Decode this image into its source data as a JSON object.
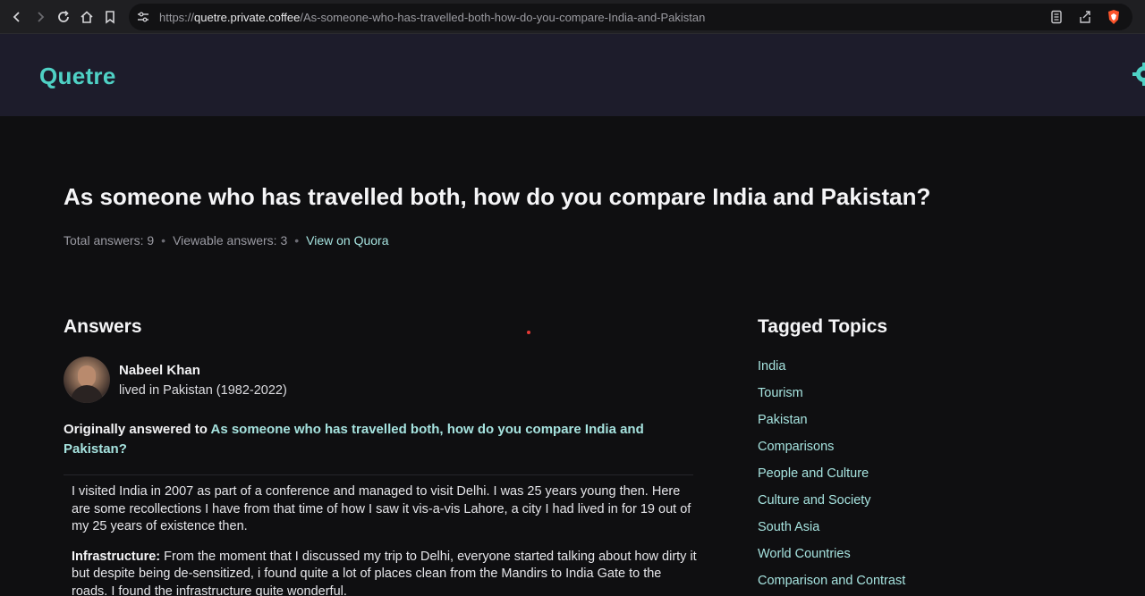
{
  "browser": {
    "url_prefix": "https://",
    "url_host": "quetre.private.coffee",
    "url_path": "/As-someone-who-has-travelled-both-how-do-you-compare-India-and-Pakistan"
  },
  "site": {
    "logo": "Quetre"
  },
  "question": {
    "title": "As someone who has travelled both, how do you compare India and Pakistan?",
    "total_answers": "Total answers: 9",
    "viewable_answers": "Viewable answers: 3",
    "view_on_quora": "View on Quora",
    "separator": "•"
  },
  "answers": {
    "heading": "Answers",
    "author_name": "Nabeel Khan",
    "author_credential": "lived in Pakistan (1982-2022)",
    "originally_prefix": "Originally answered to ",
    "originally_question": "As someone who has travelled both, how do you compare India and Pakistan?",
    "paragraph_1": "I visited India in 2007 as part of a conference and managed to visit Delhi. I was 25 years young then. Here are some recollections I have from that time of how I saw it vis-a-vis Lahore, a city I had lived in for 19 out of my 25 years of existence then.",
    "paragraph_2_label": "Infrastructure:",
    "paragraph_2_text": " From the moment that I discussed my trip to Delhi, everyone started talking about how dirty it but despite being de-sensitized, i found quite a lot of places clean from the Mandirs to India Gate to the roads. I found the infrastructure quite wonderful."
  },
  "topics": {
    "heading": "Tagged Topics",
    "items": [
      "India",
      "Tourism",
      "Pakistan",
      "Comparisons",
      "People and Culture",
      "Culture and Society",
      "South Asia",
      "World Countries",
      "Comparison and Contrast"
    ]
  },
  "colors": {
    "accent": "#4fd1c5",
    "link": "#a6e3df",
    "header_bg": "#1d1c2b",
    "page_bg": "#0f0f11"
  }
}
